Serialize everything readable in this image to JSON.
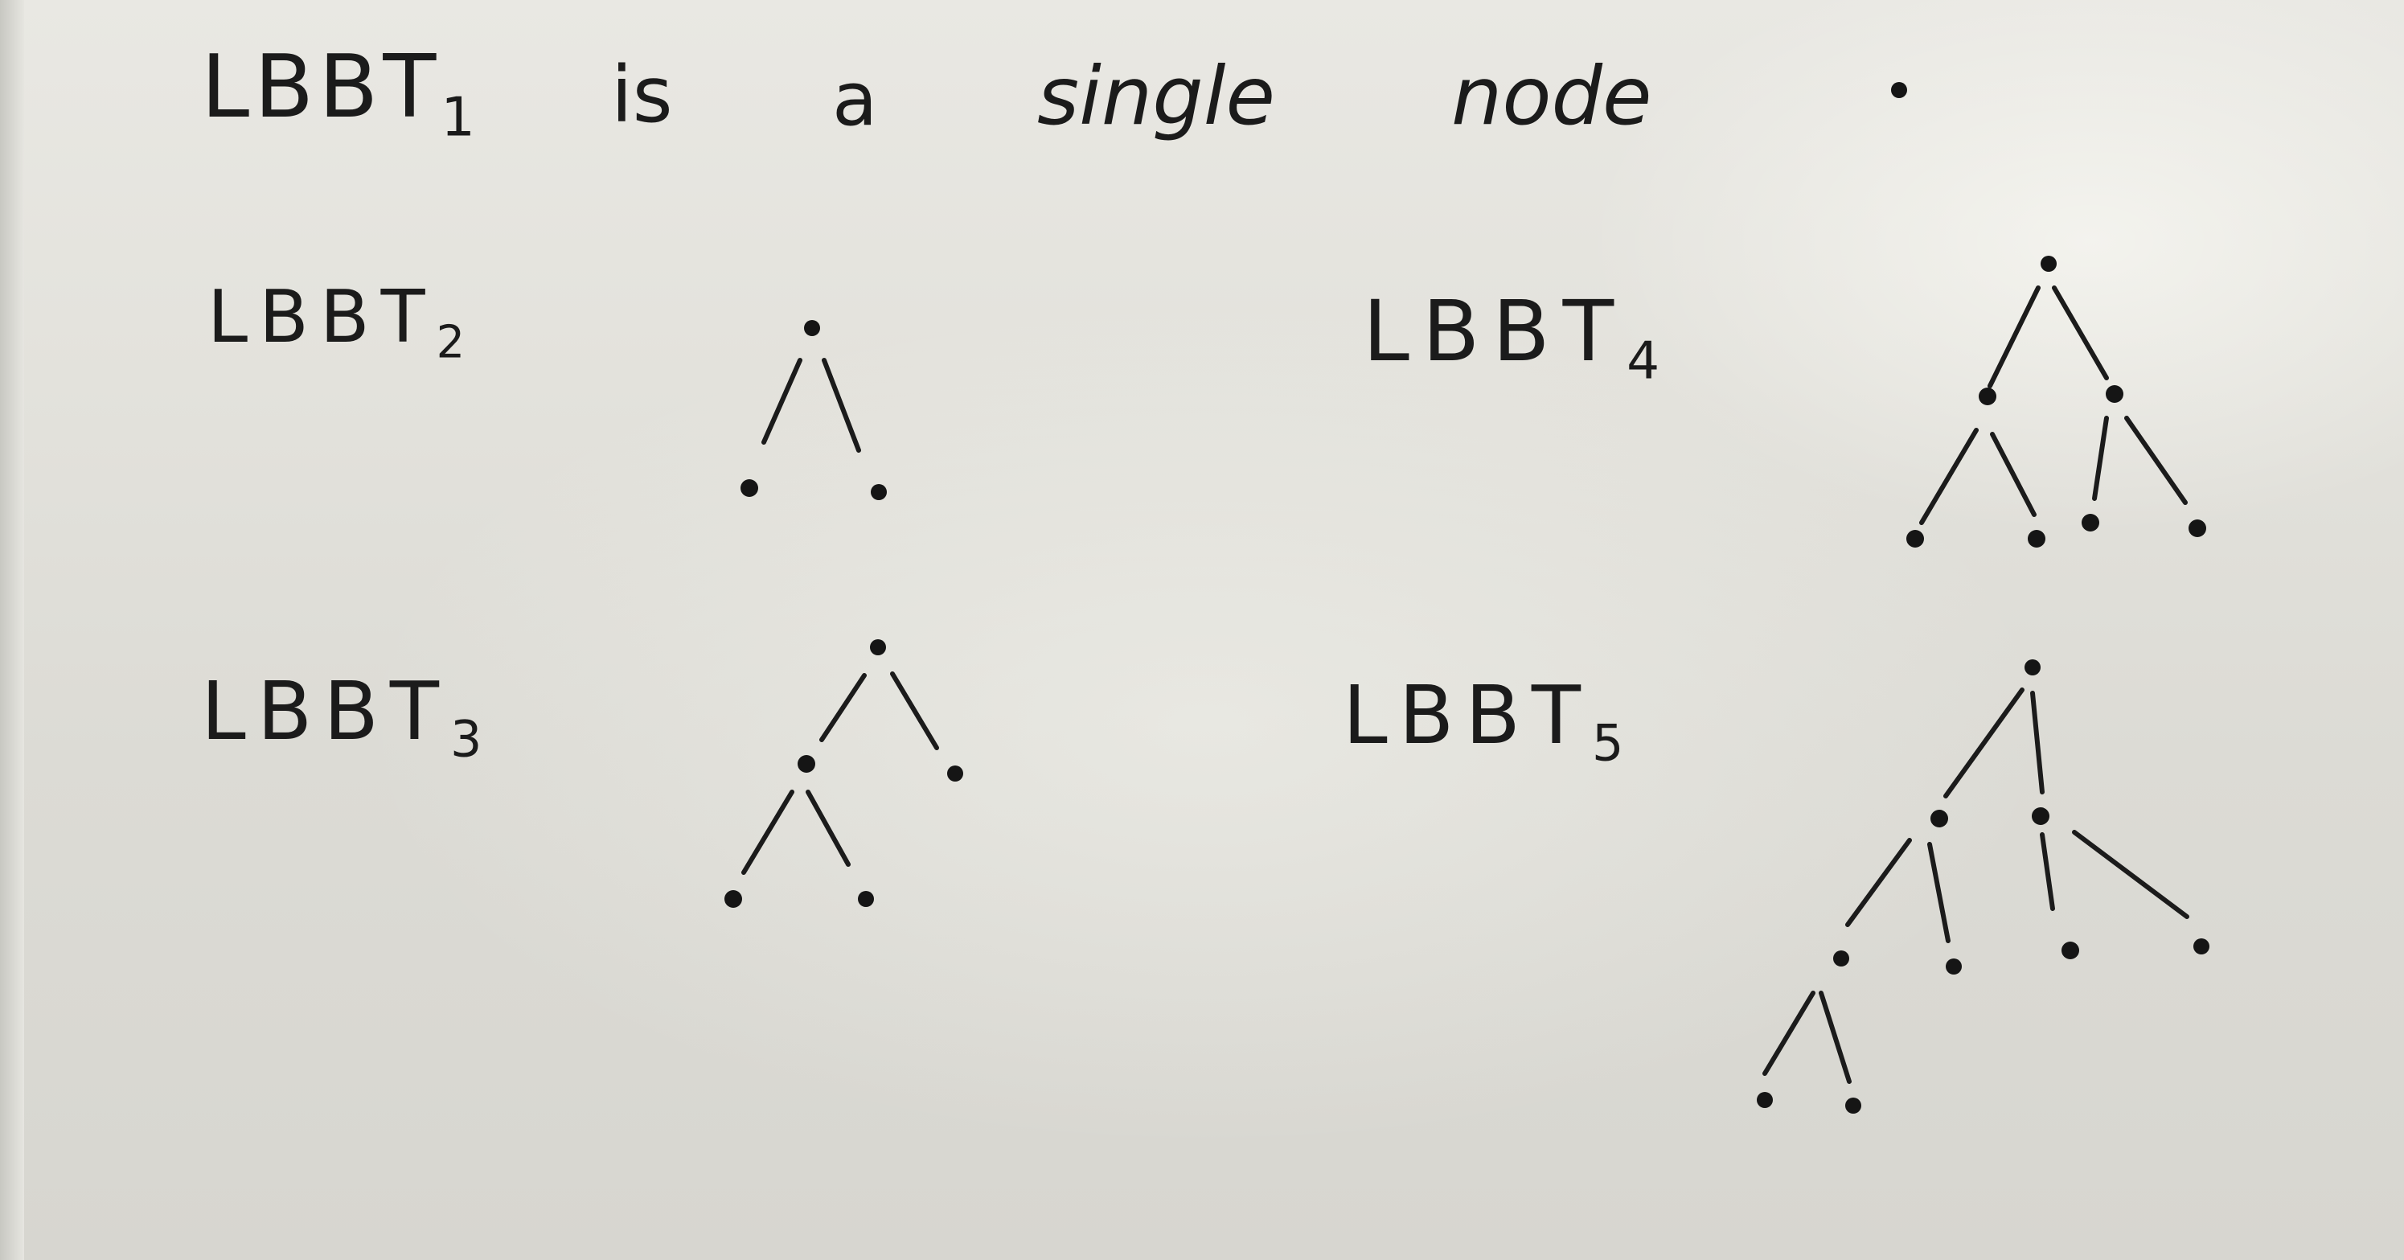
{
  "line1": {
    "lbbt": "LBBT",
    "lbbt_sub": "1",
    "is": "is",
    "a": "a",
    "single": "single",
    "node": "node"
  },
  "trees": [
    {
      "label": "LBBT",
      "sub": "2"
    },
    {
      "label": "LBBT",
      "sub": "4"
    },
    {
      "label": "LBBT",
      "sub": "3"
    },
    {
      "label": "LBBT",
      "sub": "5"
    }
  ]
}
